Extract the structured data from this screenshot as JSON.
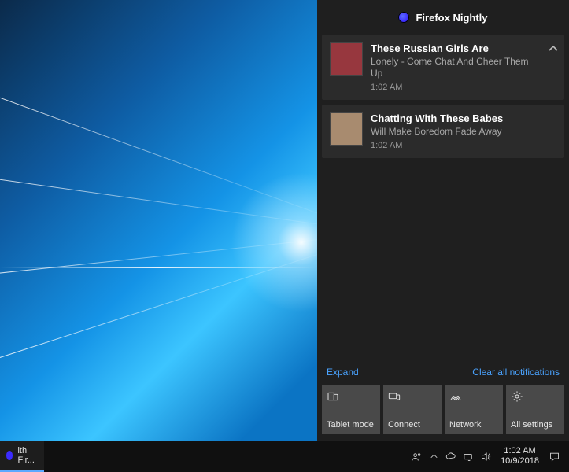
{
  "action_center": {
    "app_name": "Firefox Nightly",
    "notifications": [
      {
        "title": "These Russian Girls Are",
        "body": "Lonely - Come Chat And Cheer Them Up",
        "time": "1:02 AM"
      },
      {
        "title": "Chatting With These Babes",
        "body": "Will Make Boredom Fade Away",
        "time": "1:02 AM"
      }
    ],
    "expand_label": "Expand",
    "clear_label": "Clear all notifications",
    "quick_actions": [
      {
        "label": "Tablet mode",
        "icon": "tablet-mode-icon"
      },
      {
        "label": "Connect",
        "icon": "connect-icon"
      },
      {
        "label": "Network",
        "icon": "network-icon"
      },
      {
        "label": "All settings",
        "icon": "settings-icon"
      }
    ]
  },
  "taskbar": {
    "app_label": "ith Fir...",
    "clock_time": "1:02 AM",
    "clock_date": "10/9/2018"
  }
}
